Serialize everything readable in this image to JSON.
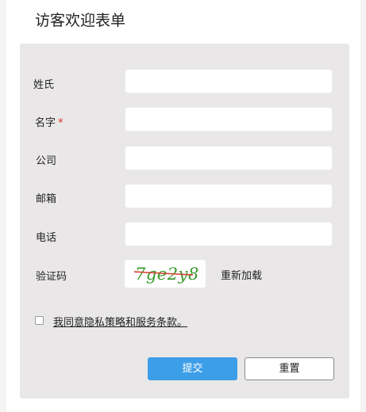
{
  "form": {
    "title": "访客欢迎表单",
    "fields": {
      "last_name": {
        "label": "姓氏",
        "value": ""
      },
      "first_name": {
        "label": "名字",
        "required_mark": "*",
        "value": ""
      },
      "company": {
        "label": "公司",
        "value": ""
      },
      "email": {
        "label": "邮箱",
        "value": ""
      },
      "phone": {
        "label": "电话",
        "value": ""
      }
    },
    "captcha": {
      "label": "验证码",
      "code": "7ge2y8",
      "reload_label": "重新加载",
      "text_color": "#3a9a2e",
      "strike_color": "#d23a2a"
    },
    "agreement": {
      "label": "我同意隐私策略和服务条款。",
      "checked": false
    },
    "buttons": {
      "submit": "提交",
      "reset": "重置"
    },
    "colors": {
      "accent": "#3d9ee8",
      "required": "#d9342b",
      "panel": "#e9e7e7"
    }
  }
}
